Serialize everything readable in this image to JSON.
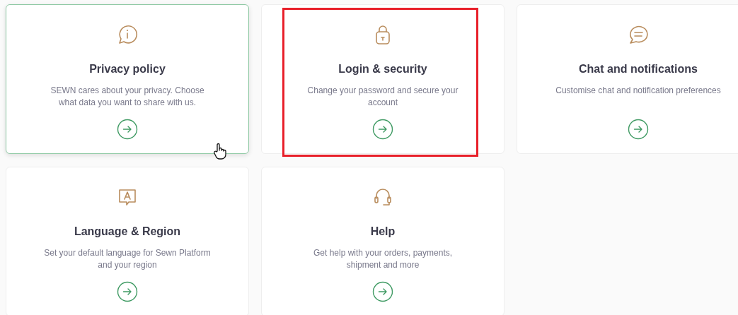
{
  "cards": [
    {
      "kind": "info",
      "title": "Privacy policy",
      "description": "SEWN cares about your privacy. Choose what data you want to share with us.",
      "hovered": true,
      "highlighted": false
    },
    {
      "kind": "lock",
      "title": "Login & security",
      "description": "Change your password and secure your account",
      "hovered": false,
      "highlighted": true
    },
    {
      "kind": "chat",
      "title": "Chat and notifications",
      "description": "Customise chat and notification preferences",
      "hovered": false,
      "highlighted": false
    },
    {
      "kind": "language",
      "title": "Language & Region",
      "description": "Set your default language for Sewn Platform and your region",
      "hovered": false,
      "highlighted": false
    },
    {
      "kind": "headset",
      "title": "Help",
      "description": "Get help with your orders, payments, shipment and more",
      "hovered": false,
      "highlighted": false
    }
  ]
}
